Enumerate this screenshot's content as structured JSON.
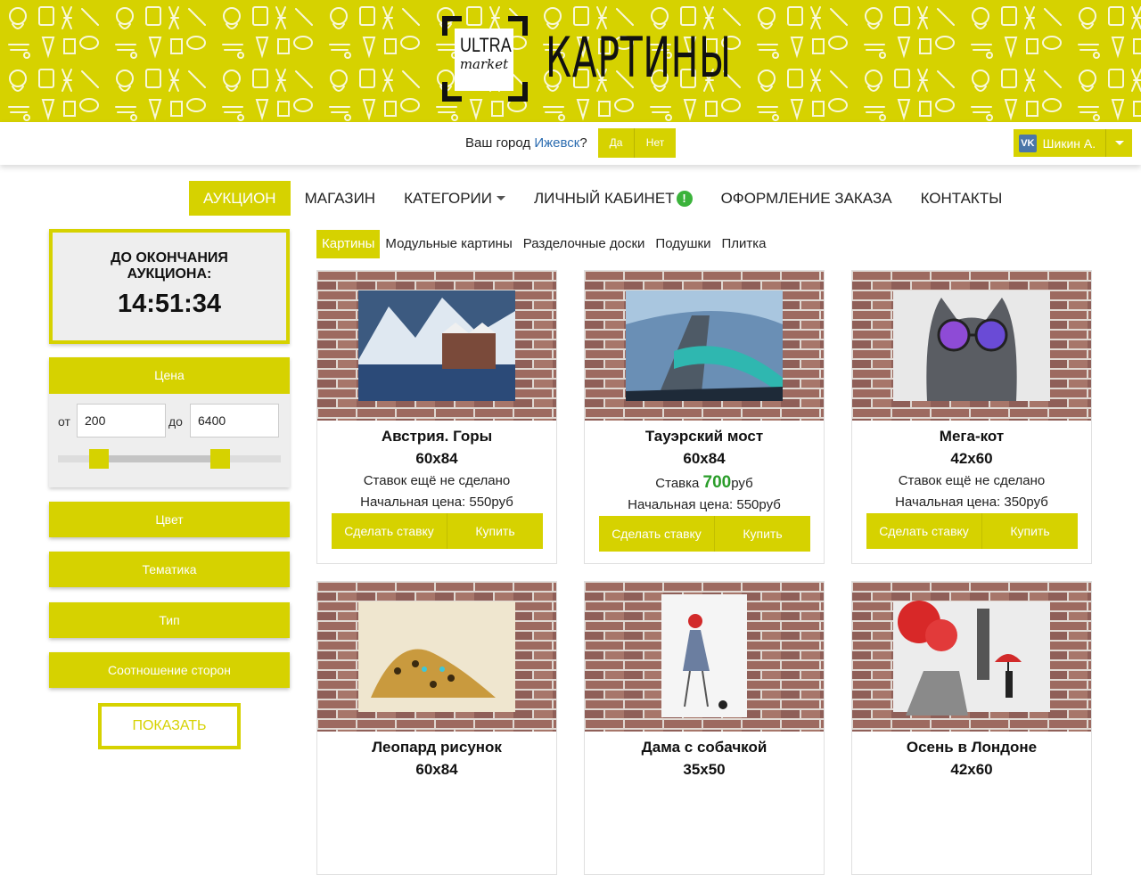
{
  "brand": {
    "logo_top": "ULTRA",
    "logo_bottom": "market",
    "title": "КАРТИНЫ"
  },
  "city": {
    "question": "Ваш город ",
    "city_name": "Ижевск",
    "question_mark": "?",
    "yes": "Да",
    "no": "Нет"
  },
  "user": {
    "network_icon": "vk-icon",
    "network_label": "VK",
    "name": "Шикин А."
  },
  "nav": {
    "items": [
      {
        "label": "АУКЦИОН",
        "active": true
      },
      {
        "label": "МАГАЗИН"
      },
      {
        "label": "КАТЕГОРИИ",
        "has_dropdown": true
      },
      {
        "label": "ЛИЧНЫЙ КАБИНЕТ",
        "badge": "!"
      },
      {
        "label": "ОФОРМЛЕНИЕ ЗАКАЗА"
      },
      {
        "label": "КОНТАКТЫ"
      }
    ]
  },
  "timer": {
    "label_line1": "ДО ОКОНЧАНИЯ",
    "label_line2": "АУКЦИОНА:",
    "value": "14:51:34"
  },
  "filters": {
    "price": {
      "title": "Цена",
      "from_label": "от",
      "from_value": "200",
      "to_label": "до",
      "to_value": "6400"
    },
    "color": "Цвет",
    "theme": "Тематика",
    "type": "Тип",
    "ratio": "Соотношение сторон",
    "show_button": "ПОКАЗАТЬ"
  },
  "subcategories": [
    {
      "label": "Картины",
      "active": true
    },
    {
      "label": "Модульные картины"
    },
    {
      "label": "Разделочные доски"
    },
    {
      "label": "Подушки"
    },
    {
      "label": "Плитка"
    }
  ],
  "products": [
    {
      "name": "Австрия. Горы",
      "size": "60x84",
      "bids": "Ставок ещё не сделано",
      "start": "Начальная цена: 550руб",
      "bid_label": "Сделать ставку",
      "buy_label": "Купить"
    },
    {
      "name": "Тауэрский мост",
      "size": "60x84",
      "bids_prefix": "Ставка ",
      "bids_amount": "700",
      "bids_suffix": "руб",
      "start": "Начальная цена: 550руб",
      "bid_label": "Сделать ставку",
      "buy_label": "Купить"
    },
    {
      "name": "Мега-кот",
      "size": "42x60",
      "bids": "Ставок ещё не сделано",
      "start": "Начальная цена: 350руб",
      "bid_label": "Сделать ставку",
      "buy_label": "Купить"
    },
    {
      "name": "Леопард рисунок",
      "size": "60x84"
    },
    {
      "name": "Дама с собачкой",
      "size": "35x50"
    },
    {
      "name": "Осень в Лондоне",
      "size": "42x60"
    }
  ],
  "colors": {
    "accent": "#d6d200",
    "brick": "#9b6a61",
    "price_green": "#2a9d2a",
    "badge_green": "#3bb33b"
  }
}
